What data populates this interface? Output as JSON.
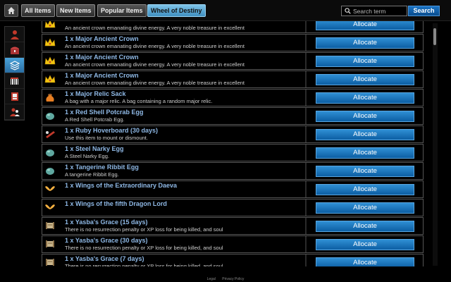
{
  "topbar": {
    "tabs": [
      {
        "label": "All Items"
      },
      {
        "label": "New Items"
      },
      {
        "label": "Popular Items"
      },
      {
        "label": "Wheel of Destiny"
      }
    ],
    "search_placeholder": "Search term",
    "search_button": "Search"
  },
  "sidebar": {
    "icons": [
      "character-icon",
      "chest-icon",
      "layers-icon",
      "barcode-icon",
      "card-icon",
      "user-group-icon"
    ],
    "active": 2
  },
  "items": [
    {
      "name": "",
      "desc": "An ancient crown emanating divine energy. A very noble treasure in excellent",
      "button": "Allocate",
      "icon": "crown-icon"
    },
    {
      "name": "1 x Major Ancient Crown",
      "desc": "An ancient crown emanating divine energy. A very noble treasure in excellent",
      "button": "Allocate",
      "icon": "crown-icon"
    },
    {
      "name": "1 x Major Ancient Crown",
      "desc": "An ancient crown emanating divine energy. A very noble treasure in excellent",
      "button": "Allocate",
      "icon": "crown-icon"
    },
    {
      "name": "1 x Major Ancient Crown",
      "desc": "An ancient crown emanating divine energy. A very noble treasure in excellent",
      "button": "Allocate",
      "icon": "crown-icon"
    },
    {
      "name": "1 x Major Relic Sack",
      "desc": "A bag with a major relic. A bag containing a random major relic.",
      "button": "Allocate",
      "icon": "sack-icon"
    },
    {
      "name": "1 x Red Shell Potcrab Egg",
      "desc": "A Red Shell Potcrab Egg.",
      "button": "Allocate",
      "icon": "egg-icon"
    },
    {
      "name": "1 x Ruby Hoverboard (30 days)",
      "desc": "Use this item to mount or dismount.",
      "button": "Allocate",
      "icon": "hoverboard-icon"
    },
    {
      "name": "1 x Steel Narky Egg",
      "desc": "A Steel Narky Egg.",
      "button": "Allocate",
      "icon": "egg-icon"
    },
    {
      "name": "1 x Tangerine Ribbit Egg",
      "desc": "A tangerine Ribbit Egg.",
      "button": "Allocate",
      "icon": "egg-icon"
    },
    {
      "name": "1 x Wings of the Extraordinary Daeva",
      "desc": "",
      "button": "Allocate",
      "icon": "wings-icon"
    },
    {
      "name": "1 x Wings of the fifth Dragon Lord",
      "desc": "",
      "button": "Allocate",
      "icon": "wings-icon"
    },
    {
      "name": "1 x Yasba's Grace (15 days)",
      "desc": "There is no resurrection penalty or XP loss for being killed, and soul",
      "button": "Allocate",
      "icon": "scroll-icon"
    },
    {
      "name": "1 x Yasba's Grace (30 days)",
      "desc": "There is no resurrection penalty or XP loss for being killed, and soul",
      "button": "Allocate",
      "icon": "scroll-icon"
    },
    {
      "name": "1 x Yasba's Grace (7 days)",
      "desc": "There is no resurrection penalty or XP loss for being killed, and soul",
      "button": "Allocate",
      "icon": "scroll-icon"
    }
  ],
  "footer": {
    "links": [
      "Legal",
      "Privacy Policy"
    ]
  }
}
